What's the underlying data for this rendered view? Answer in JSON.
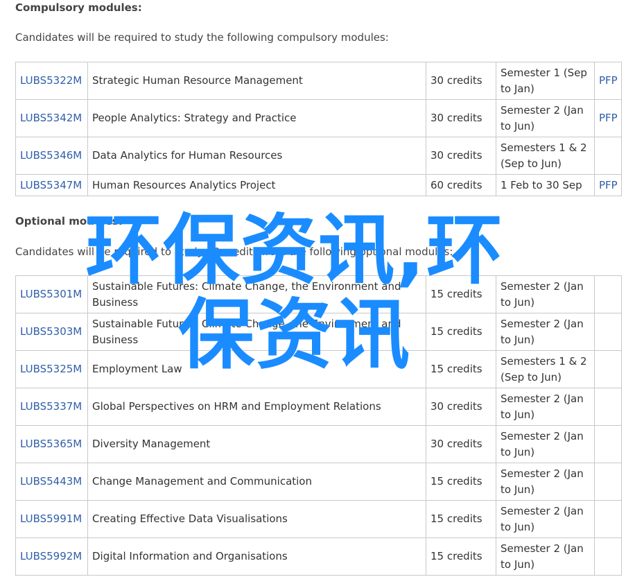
{
  "compulsory": {
    "heading": "Compulsory modules:",
    "intro": "Candidates will be required to study the following compulsory modules:",
    "rows": [
      {
        "code": "LUBS5322M",
        "title": "Strategic Human Resource Management",
        "credits": "30 credits",
        "semester": "Semester 1 (Sep to Jan)",
        "doc": "PFP"
      },
      {
        "code": "LUBS5342M",
        "title": "People Analytics: Strategy and Practice",
        "credits": "30 credits",
        "semester": "Semester 2 (Jan to Jun)",
        "doc": "PFP"
      },
      {
        "code": "LUBS5346M",
        "title": "Data Analytics for Human Resources",
        "credits": "30 credits",
        "semester": "Semesters 1 & 2 (Sep to Jun)",
        "doc": ""
      },
      {
        "code": "LUBS5347M",
        "title": "Human Resources Analytics Project",
        "credits": "60 credits",
        "semester": "1 Feb to 30 Sep",
        "doc": "PFP"
      }
    ]
  },
  "optional": {
    "heading": "Optional modules:",
    "intro": "Candidates will be required to study 30 credits from the following optional modules:",
    "rows": [
      {
        "code": "LUBS5301M",
        "title": "Sustainable Futures: Climate Change, the Environment and Business",
        "credits": "15 credits",
        "semester": "Semester 2 (Jan to Jun)",
        "doc": ""
      },
      {
        "code": "LUBS5303M",
        "title": "Sustainable Futures: Climate Change, the Environment and Business",
        "credits": "15 credits",
        "semester": "Semester 2 (Jan to Jun)",
        "doc": ""
      },
      {
        "code": "LUBS5325M",
        "title": "Employment Law",
        "credits": "15 credits",
        "semester": "Semesters 1 & 2 (Sep to Jun)",
        "doc": ""
      },
      {
        "code": "LUBS5337M",
        "title": "Global Perspectives on HRM and Employment Relations",
        "credits": "30 credits",
        "semester": "Semester 2 (Jan to Jun)",
        "doc": ""
      },
      {
        "code": "LUBS5365M",
        "title": "Diversity Management",
        "credits": "30 credits",
        "semester": "Semester 2 (Jan to Jun)",
        "doc": ""
      },
      {
        "code": "LUBS5443M",
        "title": "Change Management and Communication",
        "credits": "15 credits",
        "semester": "Semester 2 (Jan to Jun)",
        "doc": ""
      },
      {
        "code": "LUBS5991M",
        "title": "Creating Effective Data Visualisations",
        "credits": "15 credits",
        "semester": "Semester 2 (Jan to Jun)",
        "doc": ""
      },
      {
        "code": "LUBS5992M",
        "title": "Digital Information and Organisations",
        "credits": "15 credits",
        "semester": "Semester 2 (Jan to Jun)",
        "doc": ""
      }
    ]
  },
  "watermark": {
    "line1": "环保资讯,环",
    "line2": "保资讯",
    "color": "#1a8cff"
  }
}
